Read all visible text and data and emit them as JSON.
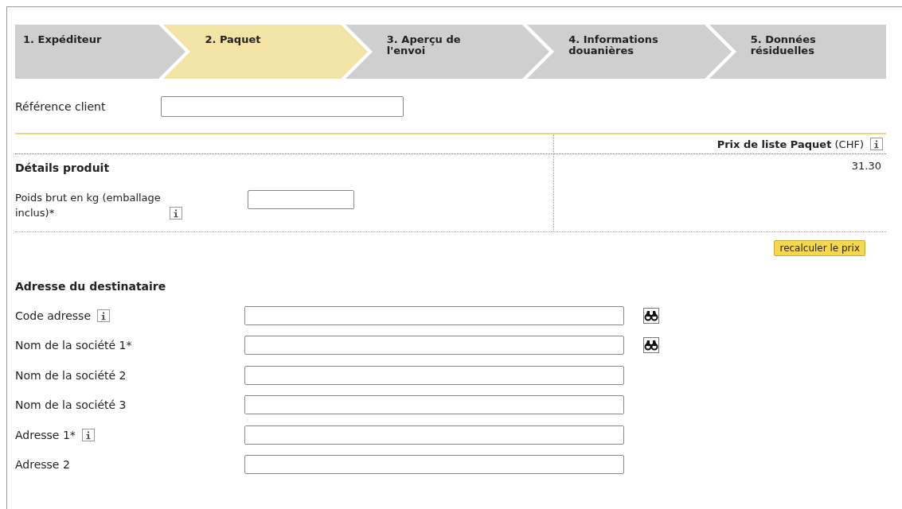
{
  "steps": [
    {
      "label": "1. Expéditeur",
      "selected": false
    },
    {
      "label": "2. Paquet",
      "selected": true
    },
    {
      "label": "3. Aperçu de l'envoi",
      "selected": false
    },
    {
      "label": "4. Informations douanières",
      "selected": false
    },
    {
      "label": "5. Données résiduelles",
      "selected": false
    }
  ],
  "reference": {
    "label": "Référence client"
  },
  "price": {
    "title": "Prix de liste Paquet",
    "currency": "(CHF)",
    "value": "31.30"
  },
  "product": {
    "heading": "Détails produit",
    "weight_label": "Poids brut en kg (emballage inclus)*"
  },
  "recalc_button": "recalculer le prix",
  "recipient": {
    "heading": "Adresse du destinataire",
    "fields": [
      {
        "label": "Code adresse",
        "info": true,
        "lookup": true
      },
      {
        "label": "Nom de la société 1*",
        "info": false,
        "lookup": true
      },
      {
        "label": "Nom de la société 2",
        "info": false,
        "lookup": false
      },
      {
        "label": "Nom de la société 3",
        "info": false,
        "lookup": false
      },
      {
        "label": "Adresse 1*",
        "info": true,
        "lookup": false
      },
      {
        "label": "Adresse 2",
        "info": false,
        "lookup": false
      }
    ]
  }
}
